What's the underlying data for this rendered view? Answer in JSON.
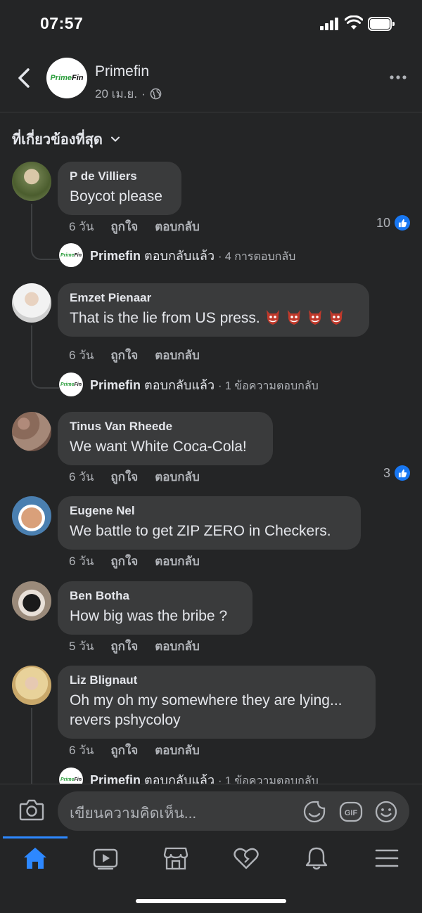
{
  "status_bar": {
    "time": "07:57"
  },
  "header": {
    "page_name": "Primefin",
    "logo_text_green": "Prime",
    "logo_text_black": "Fin",
    "date": "20 เม.ย.",
    "separator": "·"
  },
  "sort": {
    "label": "ที่เกี่ยวข้องที่สุด"
  },
  "comments": [
    {
      "author": "P de Villiers",
      "text": "Boycot please",
      "time": "6 วัน",
      "like": "ถูกใจ",
      "reply": "ตอบกลับ",
      "reactions": "10",
      "page_reply": {
        "name": "Primefin",
        "action": "ตอบกลับแล้ว",
        "count": "· 4 การตอบกลับ"
      }
    },
    {
      "author": "Emzet Pienaar",
      "text": "That is the lie from US press.",
      "time": "6 วัน",
      "like": "ถูกใจ",
      "reply": "ตอบกลับ",
      "page_reply": {
        "name": "Primefin",
        "action": "ตอบกลับแล้ว",
        "count": "· 1 ข้อความตอบกลับ"
      }
    },
    {
      "author": "Tinus Van Rheede",
      "text": "We want White Coca-Cola!",
      "time": "6 วัน",
      "like": "ถูกใจ",
      "reply": "ตอบกลับ",
      "reactions": "3"
    },
    {
      "author": "Eugene Nel",
      "text": "We battle to get ZIP ZERO in Checkers.",
      "time": "6 วัน",
      "like": "ถูกใจ",
      "reply": "ตอบกลับ"
    },
    {
      "author": "Ben Botha",
      "text": "How big was the bribe ?",
      "time": "5 วัน",
      "like": "ถูกใจ",
      "reply": "ตอบกลับ"
    },
    {
      "author": "Liz Blignaut",
      "text_line1": "Oh my oh my somewhere they are lying...",
      "text_line2": "revers pshycoloy",
      "time": "6 วัน",
      "like": "ถูกใจ",
      "reply": "ตอบกลับ",
      "page_reply": {
        "name": "Primefin",
        "action": "ตอบกลับแล้ว",
        "count": "· 1 ข้อความตอบกลับ"
      }
    }
  ],
  "composer": {
    "placeholder": "เขียนความคิดเห็น...",
    "gif_label": "GIF"
  },
  "colors": {
    "background": "#242526",
    "bubble": "#3a3b3c",
    "accent": "#2d88ff",
    "like_blue": "#1877f2"
  },
  "icons": [
    "back-icon",
    "globe-icon",
    "more-icon",
    "chevron-down-icon",
    "camera-icon",
    "sticker-icon",
    "gif-icon",
    "emoji-icon",
    "home-icon",
    "watch-icon",
    "marketplace-icon",
    "dating-icon",
    "notifications-icon",
    "menu-icon"
  ]
}
